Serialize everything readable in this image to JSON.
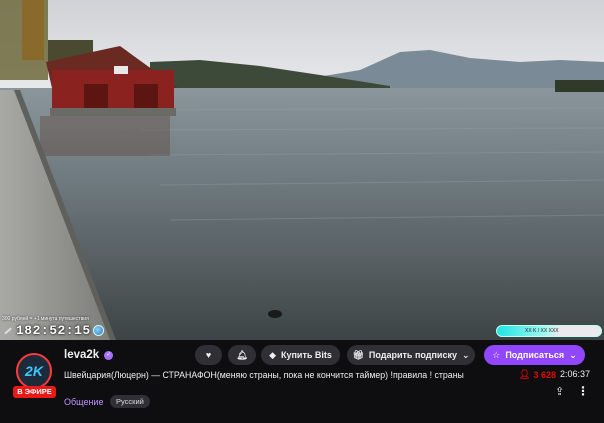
{
  "video": {
    "overlay_text": "300 рублей = +1 минута путешествия",
    "timer": "182:52:15",
    "goal_text": "XX K / XX XXX"
  },
  "channel": {
    "avatar_text": "2K",
    "live_label": "В ЭФИРЕ",
    "name": "leva2k",
    "title": "Швейцария(Люцерн) — СТРАНАФОН(меняю страны, пока не кончится таймер) !правила ! страны",
    "category": "Общение",
    "tag": "Русский"
  },
  "actions": {
    "bits_label": "Купить Bits",
    "gift_label": "Подарить подписку",
    "subscribe_label": "Подписаться"
  },
  "stats": {
    "viewers": "3 628",
    "uptime": "2:06:37"
  },
  "colors": {
    "accent": "#9147ff",
    "live": "#e91916",
    "viewers": "#eb0400",
    "category": "#bf94ff"
  }
}
